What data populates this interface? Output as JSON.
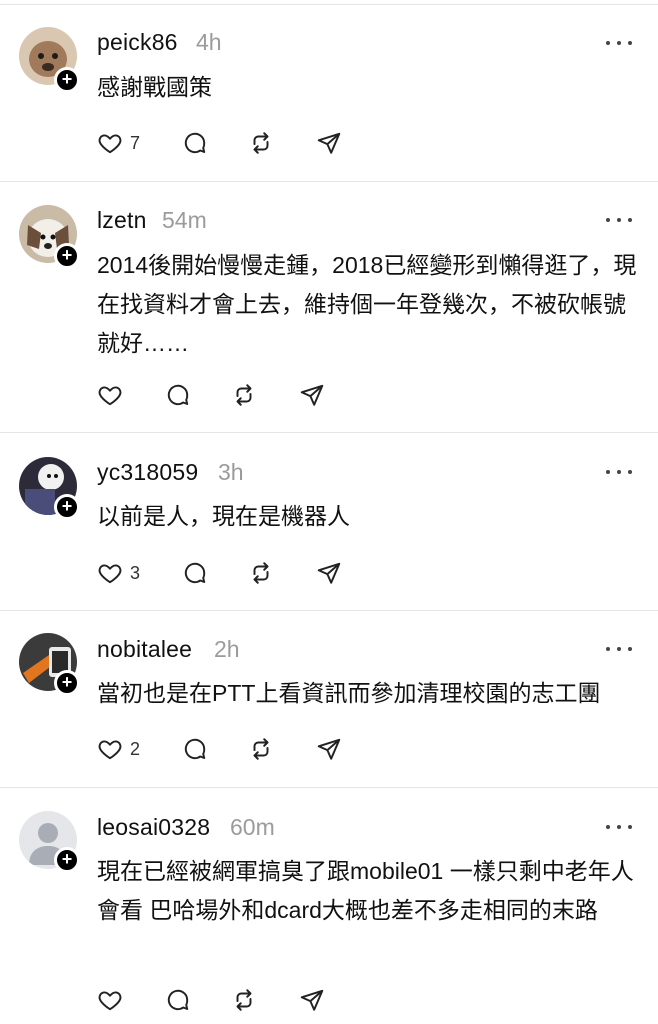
{
  "posts": [
    {
      "username": "peick86",
      "time": "4h",
      "text": "感謝戰國策",
      "likes": "7",
      "avatar_color": "#a07a5a",
      "avatar_bg": "#d9c7b1"
    },
    {
      "username": "lzetn",
      "time": "54m",
      "text": "2014後開始慢慢走鍾，2018已經變形到懶得逛了，現在找資料才會上去，維持個一年登幾次，不被砍帳號就好……",
      "likes": "",
      "avatar_color": "#6b4f3a",
      "avatar_bg": "#c9bba6"
    },
    {
      "username": "yc318059",
      "time": "3h",
      "text": "以前是人，現在是機器人",
      "likes": "3",
      "avatar_color": "#4a4d7a",
      "avatar_bg": "#2d2b3a"
    },
    {
      "username": "nobitalee",
      "time": "2h",
      "text": "當初也是在PTT上看資訊而參加清理校園的志工團",
      "likes": "2",
      "avatar_color": "#e2761f",
      "avatar_bg": "#3b3b3b"
    },
    {
      "username": "leosai0328",
      "time": "60m",
      "text": "現在已經被網軍搞臭了跟mobile01 一樣只剩中老年人會看 巴哈場外和dcard大概也差不多走相同的末路",
      "likes": "",
      "avatar_color": "#c5c9cf",
      "avatar_bg": "#e4e6e9"
    }
  ]
}
